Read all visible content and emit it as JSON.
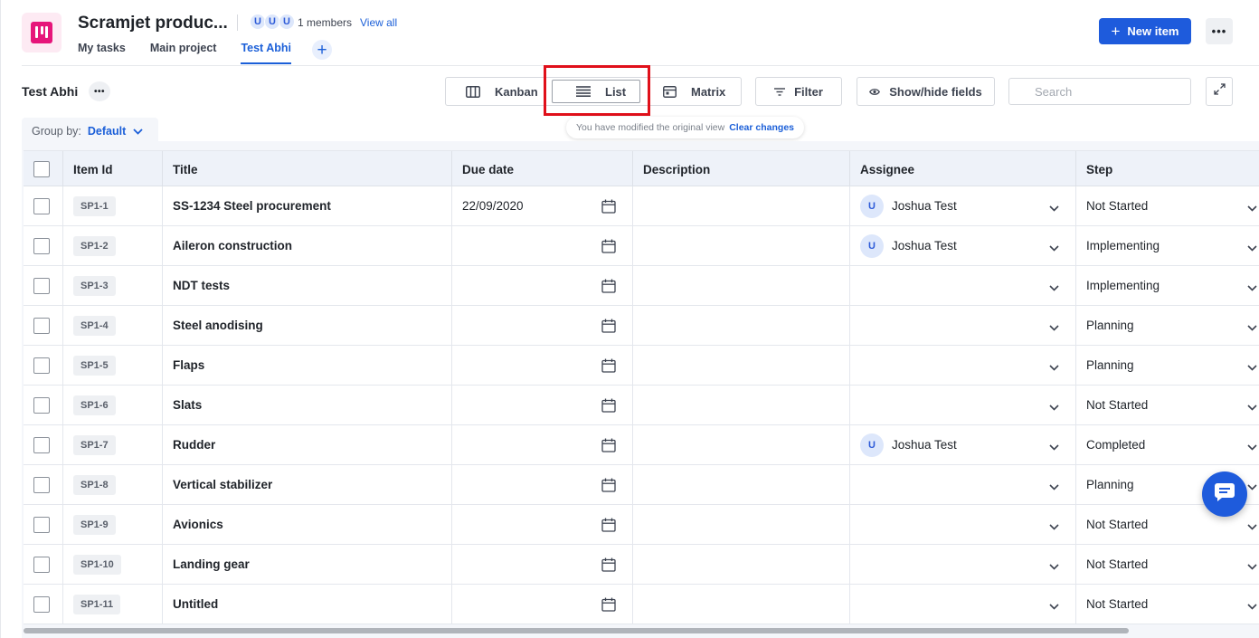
{
  "project": {
    "title": "Scramjet produc...",
    "member_initials": [
      "U",
      "U",
      "U"
    ],
    "members_text": "1 members",
    "view_all": "View all"
  },
  "tabs": [
    {
      "label": "My tasks"
    },
    {
      "label": "Main project"
    },
    {
      "label": "Test Abhi",
      "active": true
    }
  ],
  "header": {
    "new_item": "New item"
  },
  "view": {
    "title": "Test Abhi",
    "modes": {
      "kanban": "Kanban",
      "list": "List",
      "matrix": "Matrix"
    },
    "filter": "Filter",
    "show_hide": "Show/hide fields",
    "search_placeholder": "Search",
    "hint_message": "You have modified the original view",
    "clear_changes": "Clear changes",
    "group_by_label": "Group by:",
    "group_by_value": "Default"
  },
  "table": {
    "columns": [
      "Item Id",
      "Title",
      "Due date",
      "Description",
      "Assignee",
      "Step"
    ],
    "rows": [
      {
        "id": "SP1-1",
        "title": "SS-1234 Steel procurement",
        "due": "22/09/2020",
        "description": "",
        "assignee_initial": "U",
        "assignee": "Joshua Test",
        "step": "Not Started"
      },
      {
        "id": "SP1-2",
        "title": "Aileron construction",
        "due": "",
        "description": "",
        "assignee_initial": "U",
        "assignee": "Joshua Test",
        "step": "Implementing"
      },
      {
        "id": "SP1-3",
        "title": "NDT tests",
        "due": "",
        "description": "",
        "assignee_initial": "",
        "assignee": "",
        "step": "Implementing"
      },
      {
        "id": "SP1-4",
        "title": "Steel anodising",
        "due": "",
        "description": "",
        "assignee_initial": "",
        "assignee": "",
        "step": "Planning"
      },
      {
        "id": "SP1-5",
        "title": "Flaps",
        "due": "",
        "description": "",
        "assignee_initial": "",
        "assignee": "",
        "step": "Planning"
      },
      {
        "id": "SP1-6",
        "title": "Slats",
        "due": "",
        "description": "",
        "assignee_initial": "",
        "assignee": "",
        "step": "Not Started"
      },
      {
        "id": "SP1-7",
        "title": "Rudder",
        "due": "",
        "description": "",
        "assignee_initial": "U",
        "assignee": "Joshua Test",
        "step": "Completed"
      },
      {
        "id": "SP1-8",
        "title": "Vertical stabilizer",
        "due": "",
        "description": "",
        "assignee_initial": "",
        "assignee": "",
        "step": "Planning"
      },
      {
        "id": "SP1-9",
        "title": "Avionics",
        "due": "",
        "description": "",
        "assignee_initial": "",
        "assignee": "",
        "step": "Not Started"
      },
      {
        "id": "SP1-10",
        "title": "Landing gear",
        "due": "",
        "description": "",
        "assignee_initial": "",
        "assignee": "",
        "step": "Not Started"
      },
      {
        "id": "SP1-11",
        "title": "Untitled",
        "due": "",
        "description": "",
        "assignee_initial": "",
        "assignee": "",
        "step": "Not Started"
      }
    ]
  },
  "colors": {
    "accent": "#1e5bdc",
    "logo": "#e6157a",
    "highlight": "#e0101a"
  },
  "icons": [
    "logo-icon",
    "plus-icon",
    "more-icon",
    "kanban-icon",
    "list-icon",
    "matrix-icon",
    "filter-icon",
    "eye-icon",
    "search-icon",
    "expand-icon",
    "chevron-down-icon",
    "calendar-icon",
    "chat-icon"
  ]
}
